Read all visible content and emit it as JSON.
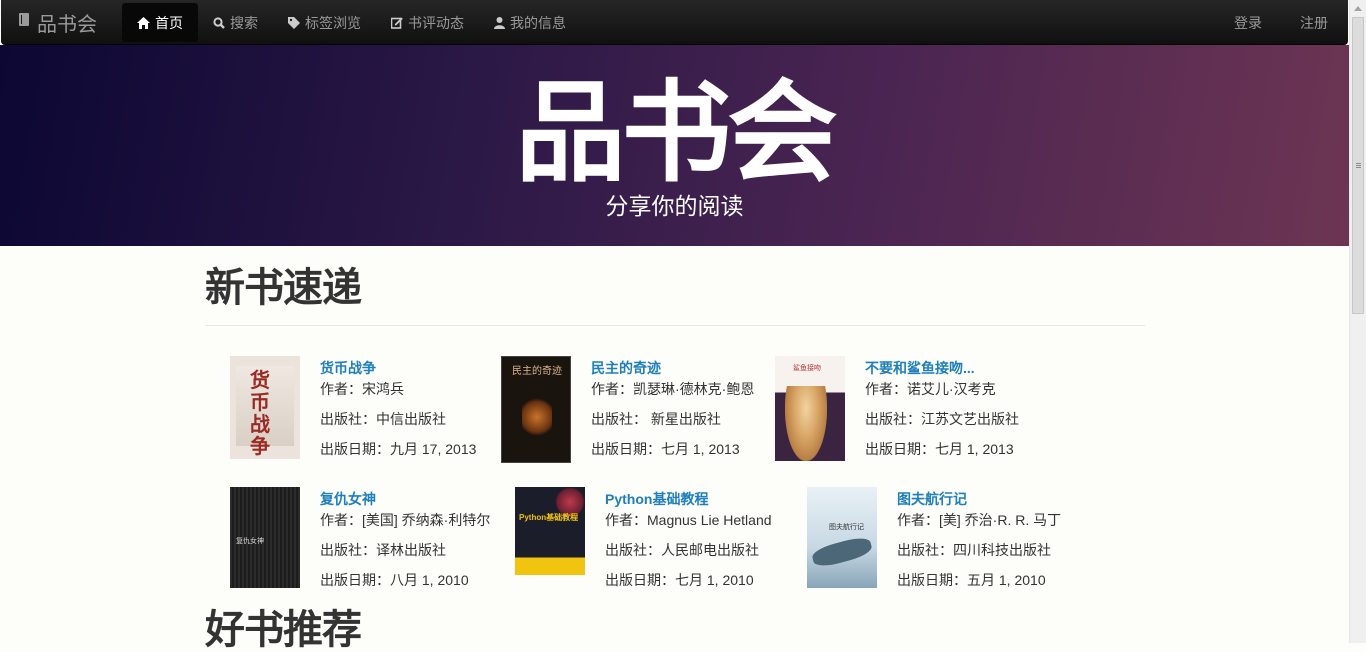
{
  "navbar": {
    "brand": "品书会",
    "items": [
      {
        "label": "首页",
        "icon": "home-icon",
        "active": true
      },
      {
        "label": "搜索",
        "icon": "search-icon"
      },
      {
        "label": "标签浏览",
        "icon": "tag-icon"
      },
      {
        "label": "书评动态",
        "icon": "edit-icon"
      },
      {
        "label": "我的信息",
        "icon": "user-icon"
      }
    ],
    "right": {
      "login": "登录",
      "register": "注册"
    }
  },
  "hero": {
    "title": "品书会",
    "subtitle": "分享你的阅读"
  },
  "sections": {
    "new_books": "新书速递",
    "recommended": "好书推荐"
  },
  "books": [
    {
      "title": "货币战争",
      "author": "作者：宋鸿兵",
      "publisher": "出版社：中信出版社",
      "date": "出版日期：九月 17, 2013",
      "cover_text": "货币战争"
    },
    {
      "title": "民主的奇迹",
      "author": "作者：凯瑟琳·德林克·鲍恩",
      "publisher": "出版社： 新星出版社",
      "date": "出版日期：七月 1, 2013",
      "cover_text": "民主的奇迹"
    },
    {
      "title": "不要和鲨鱼接吻...",
      "author": "作者：诺艾儿·汉考克",
      "publisher": "出版社：江苏文艺出版社",
      "date": "出版日期：七月 1, 2013",
      "cover_text": "鲨鱼接吻"
    },
    {
      "title": "复仇女神",
      "author": "作者：[美国] 乔纳森·利特尔",
      "publisher": "出版社：译林出版社",
      "date": "出版日期：八月 1, 2010",
      "cover_text": "复仇女神"
    },
    {
      "title": "Python基础教程",
      "author": "作者：Magnus Lie Hetland",
      "publisher": "出版社：人民邮电出版社",
      "date": "出版日期：七月 1, 2010",
      "cover_text": "Python基础教程"
    },
    {
      "title": "图夫航行记",
      "author": "作者：[美] 乔治·R. R. 马丁",
      "publisher": "出版社：四川科技出版社",
      "date": "出版日期：五月 1, 2010",
      "cover_text": "图夫航行记"
    }
  ]
}
